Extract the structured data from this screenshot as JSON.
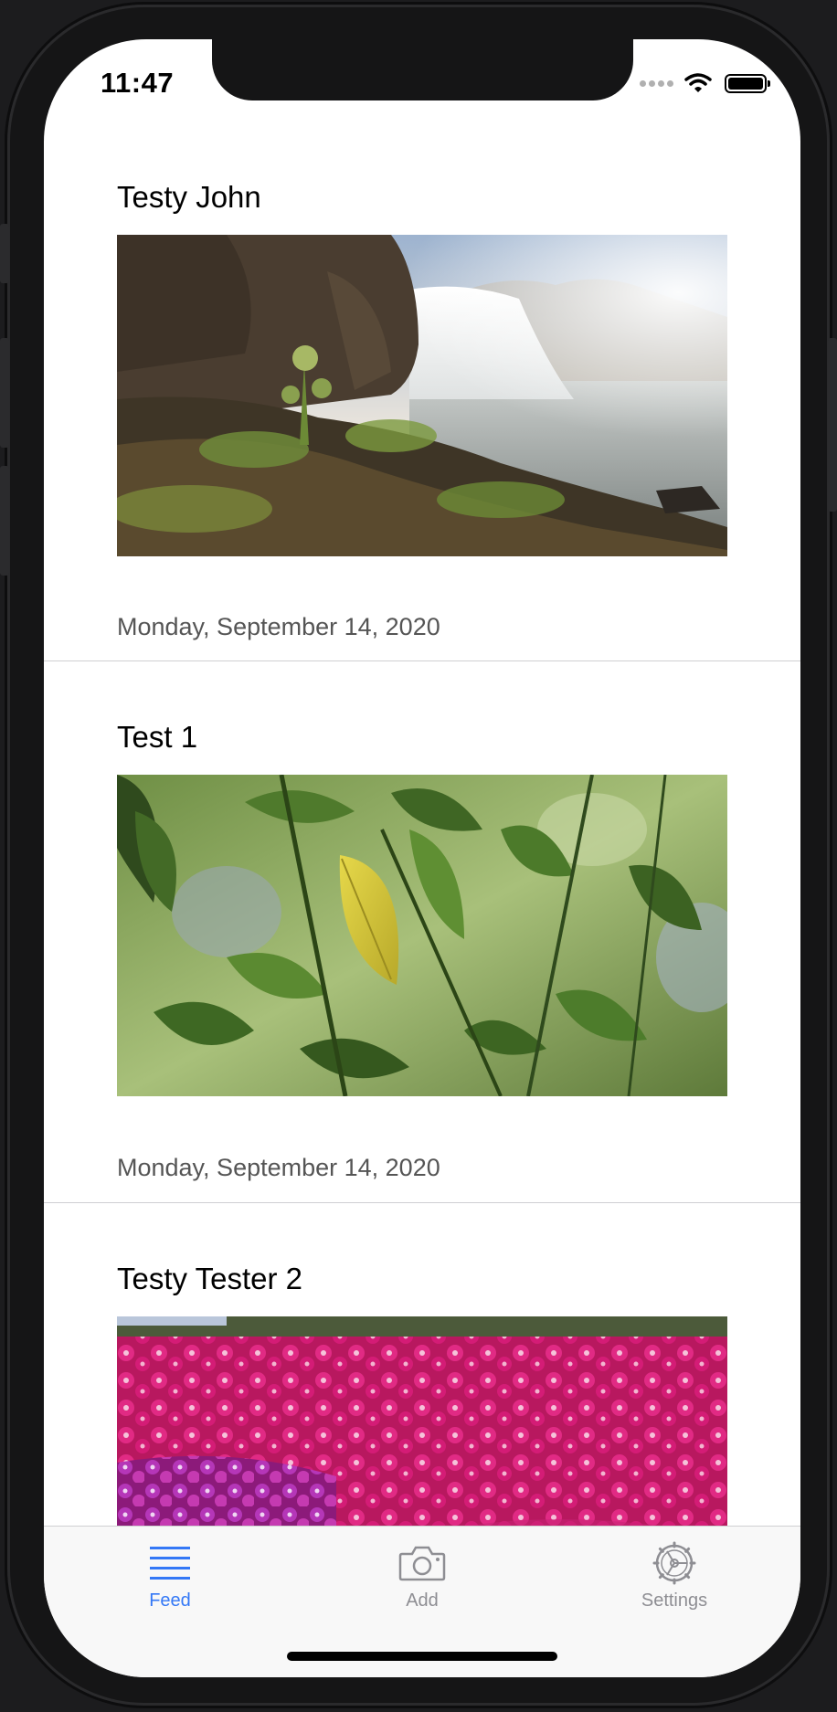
{
  "status_bar": {
    "time": "11:47"
  },
  "feed": {
    "posts": [
      {
        "title": "Testy John",
        "date": "Monday, September 14, 2020",
        "photo": "waterfall-photo"
      },
      {
        "title": "Test 1",
        "date": "Monday, September 14, 2020",
        "photo": "leaves-photo"
      },
      {
        "title": "Testy Tester 2",
        "date": "",
        "photo": "flowers-photo"
      }
    ]
  },
  "tabbar": {
    "tabs": [
      {
        "label": "Feed",
        "icon": "list-icon",
        "active": true
      },
      {
        "label": "Add",
        "icon": "camera-icon",
        "active": false
      },
      {
        "label": "Settings",
        "icon": "gear-icon",
        "active": false
      }
    ],
    "active_color": "#3478f6",
    "inactive_color": "#8e8e93"
  }
}
